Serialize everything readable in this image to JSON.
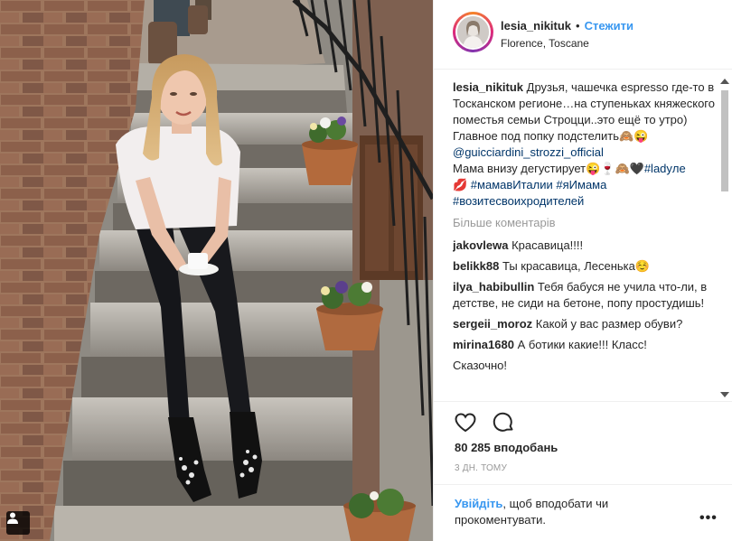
{
  "post": {
    "username": "lesia_nikituk",
    "dot": "•",
    "follow_label": "Стежити",
    "location": "Florence, Toscane"
  },
  "caption": {
    "username": "lesia_nikituk",
    "text_1": "Друзья, чашечка espresso где-то в Тосканском регионе…на ступеньках княжеского поместья семьи Строцци..это ещё то утро)",
    "text_2": "Главное под попку подстелить🙈😜",
    "mention": "@guicciardini_strozzi_official",
    "text_3": "Мама внизу дегустирует😜🍷🙈🖤",
    "hashtag_1": "#ladyле",
    "hashtag_2": "💋 #мамавИталии",
    "hashtag_3": "#яИмама",
    "hashtag_4": "#возитесвоихродителей"
  },
  "more_comments_label": "Більше коментарів",
  "comments": [
    {
      "user": "jakovlewa",
      "text": "Красавица!!!!"
    },
    {
      "user": "belikk88",
      "text": "Ты красавица, Лесенька☺️"
    },
    {
      "user": "ilya_habibullin",
      "text": "Тебя бабуся не учила что-ли, в детстве, не сиди на бетоне, попу простудишь!"
    },
    {
      "user": "sergeii_moroz",
      "text": "Какой у вас размер обуви?"
    },
    {
      "user": "mirina1680",
      "text": "А ботики какие!!! Класс!"
    },
    {
      "user": "",
      "text": "Сказочно!"
    }
  ],
  "actions": {
    "like_icon": "heart-icon",
    "comment_icon": "comment-icon",
    "likes_text": "80 285 вподобань",
    "time_text": "3 ДН. ТОМУ"
  },
  "login_prompt": {
    "link_text": "Увійдіть",
    "rest_text": ", щоб вподобати чи прокоментувати."
  },
  "more_options_label": "•••",
  "colors": {
    "link_blue": "#3897f0",
    "hashtag_blue": "#003569",
    "muted_gray": "#999999",
    "border": "#efefef"
  }
}
